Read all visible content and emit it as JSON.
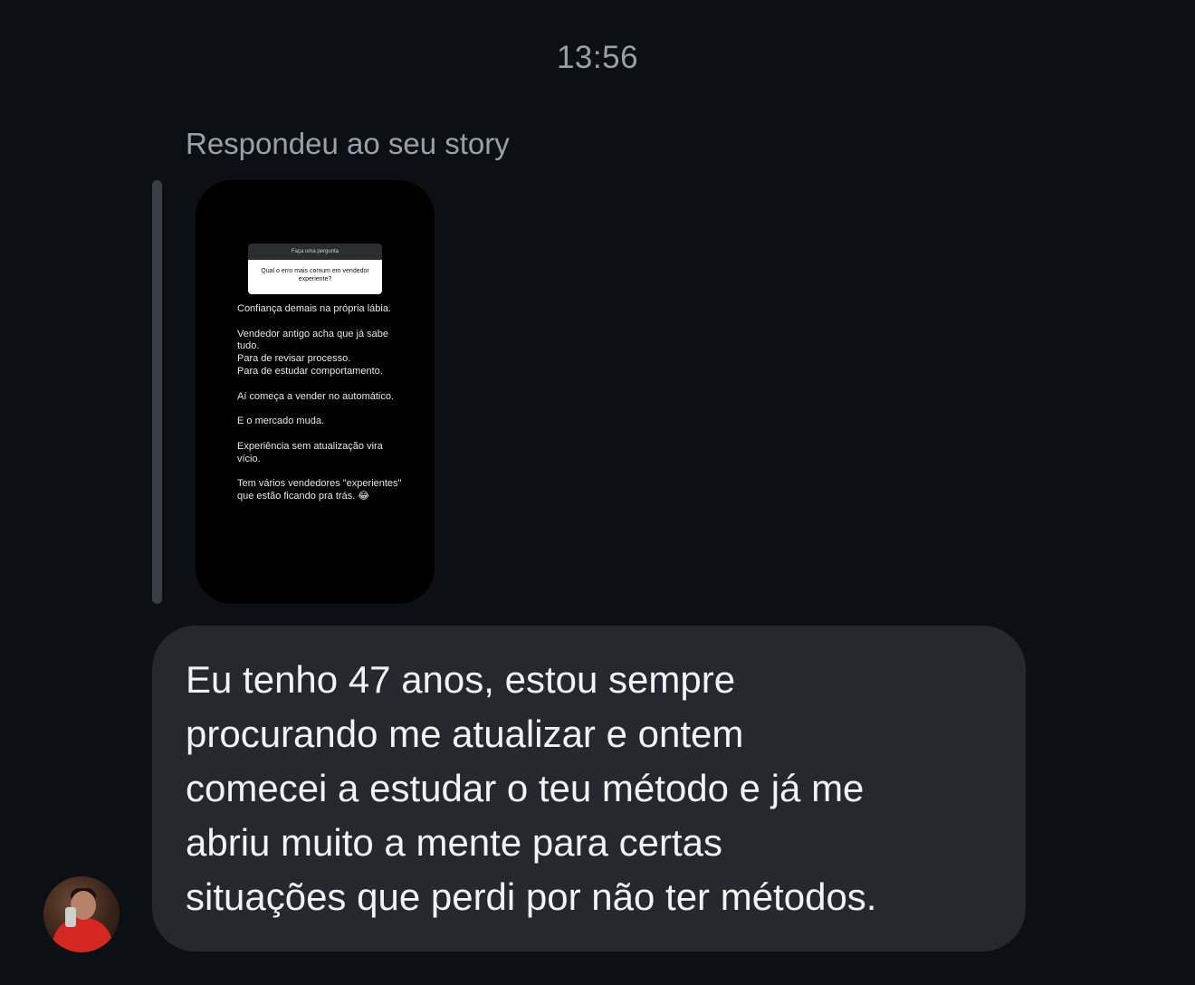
{
  "header": {
    "timestamp": "13:56"
  },
  "story_reply": {
    "label": "Respondeu ao seu story",
    "story": {
      "question_header": "Faça uma pergunta",
      "question": "Qual o erro mais comum em vendedor experiente?",
      "answer": "Confiança demais na própria lábia.\n\nVendedor antigo acha que já sabe tudo.\nPara de revisar processo.\nPara de estudar comportamento.\n\nAí começa a vender no automático.\n\nE o mercado muda.\n\nExperiência sem atualização vira vício.\n\nTem vários vendedores \"experientes\" que estão ficando pra trás. 😂"
    }
  },
  "message": {
    "text": "Eu tenho 47 anos, estou sempre\nprocurando me atualizar e ontem\ncomecei a estudar o teu método e já me\nabriu muito a mente para certas\nsituações que perdi por não ter métodos."
  },
  "sender": {
    "avatar_icon": "user-avatar"
  },
  "colors": {
    "background": "#0c0f14",
    "bubble": "#25282e",
    "secondary_text": "#9aa0aa",
    "primary_text": "#f2f3f5"
  }
}
